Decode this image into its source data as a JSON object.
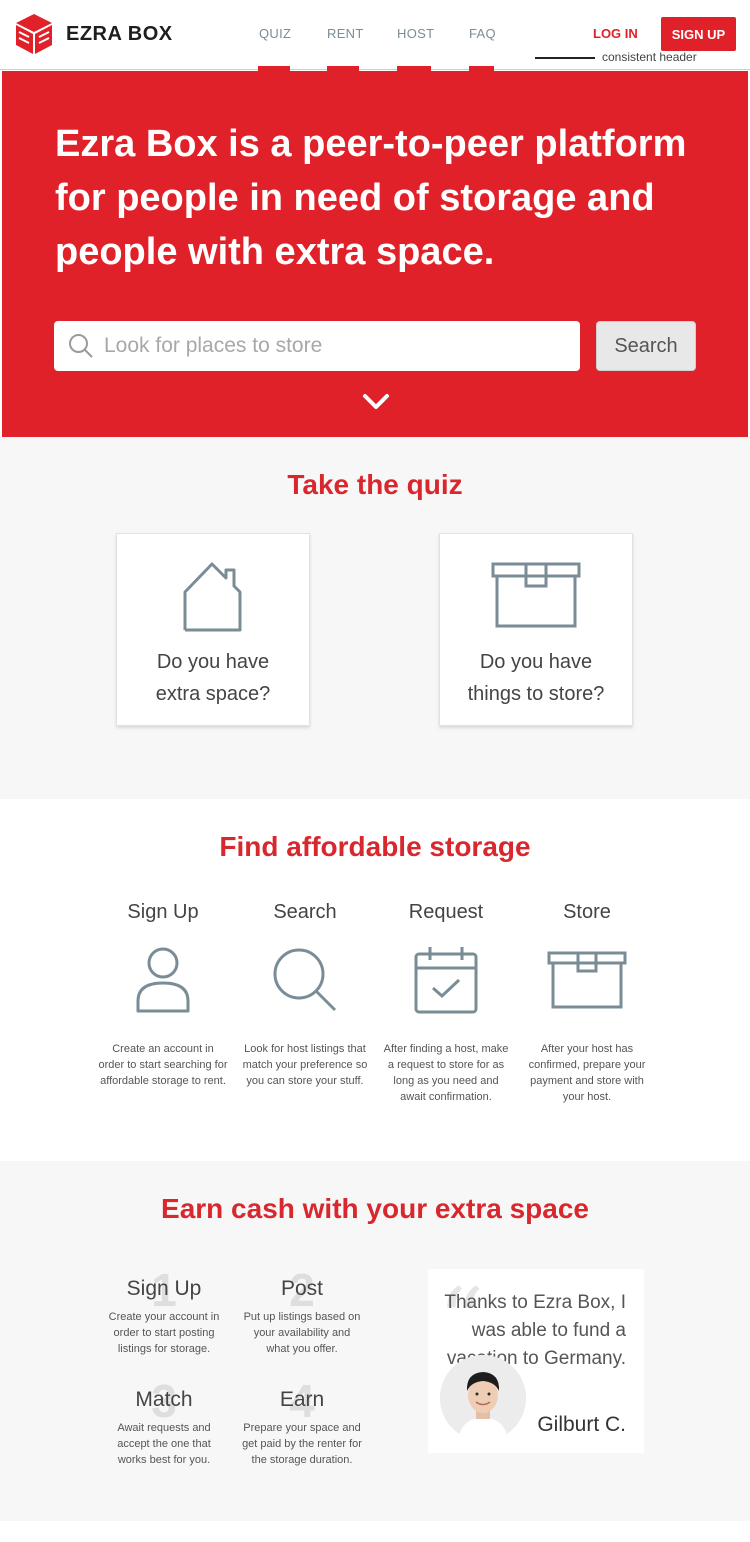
{
  "header": {
    "brand": "EZRA BOX",
    "nav": [
      "QUIZ",
      "RENT",
      "HOST",
      "FAQ"
    ],
    "login": "LOG IN",
    "signup": "SIGN UP",
    "annotation": "consistent header"
  },
  "hero": {
    "headline": "Ezra Box is a peer-to-peer platform for people in need of storage and people with extra space.",
    "search_placeholder": "Look for places to store",
    "search_button": "Search"
  },
  "quiz": {
    "title": "Take the quiz",
    "cards": [
      {
        "line1": "Do you have",
        "line2": "extra space?",
        "icon": "house-icon"
      },
      {
        "line1": "Do you have",
        "line2": "things to store?",
        "icon": "box-icon"
      }
    ]
  },
  "find": {
    "title": "Find affordable storage",
    "steps": [
      {
        "title": "Sign Up",
        "icon": "user-icon",
        "desc": "Create an account in order to start searching for affordable storage to rent."
      },
      {
        "title": "Search",
        "icon": "search-icon",
        "desc": "Look for host listings that match your preference so you can store your stuff."
      },
      {
        "title": "Request",
        "icon": "calendar-check-icon",
        "desc": "After finding a host, make a request to store for as long as you need and await confirmation."
      },
      {
        "title": "Store",
        "icon": "box-icon",
        "desc": "After your host has confirmed, prepare your payment and store with your host."
      }
    ]
  },
  "earn": {
    "title": "Earn cash with your extra space",
    "steps": [
      {
        "num": "1",
        "title": "Sign Up",
        "desc": "Create your account in order to start posting listings for storage."
      },
      {
        "num": "2",
        "title": "Post",
        "desc": "Put up listings based on your availability and what you offer."
      },
      {
        "num": "3",
        "title": "Match",
        "desc": "Await requests and accept the one that works best for you."
      },
      {
        "num": "4",
        "title": "Earn",
        "desc": "Prepare your space and get paid by the renter for the storage duration."
      }
    ],
    "testimonial": {
      "quote": "Thanks to Ezra Box, I was able to fund a vacation to Germany.",
      "name": "Gilburt C."
    }
  },
  "colors": {
    "brand_red": "#e02129",
    "icon_gray": "#7a8c96",
    "section_bg": "#f7f7f7"
  }
}
